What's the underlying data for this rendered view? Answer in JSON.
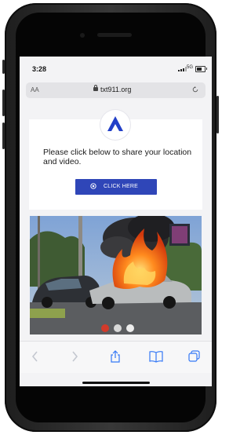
{
  "status_bar": {
    "time": "3:28",
    "network": "5G"
  },
  "browser": {
    "text_size_label": "AA",
    "domain": "txt911.org"
  },
  "page": {
    "message": "Please click below to share your location and video.",
    "cta_label": "CLICK HERE"
  },
  "video": {
    "controls": [
      "record-icon",
      "camera-switch-icon",
      "stop-icon"
    ]
  },
  "toolbar": {
    "icons": [
      "back-icon",
      "forward-icon",
      "share-icon",
      "bookmarks-icon",
      "tabs-icon"
    ]
  },
  "colors": {
    "accent": "#2f46b8",
    "logo_blue": "#2340c8",
    "screen_bg": "#f3f3f5",
    "record_red": "#d23a2a"
  }
}
